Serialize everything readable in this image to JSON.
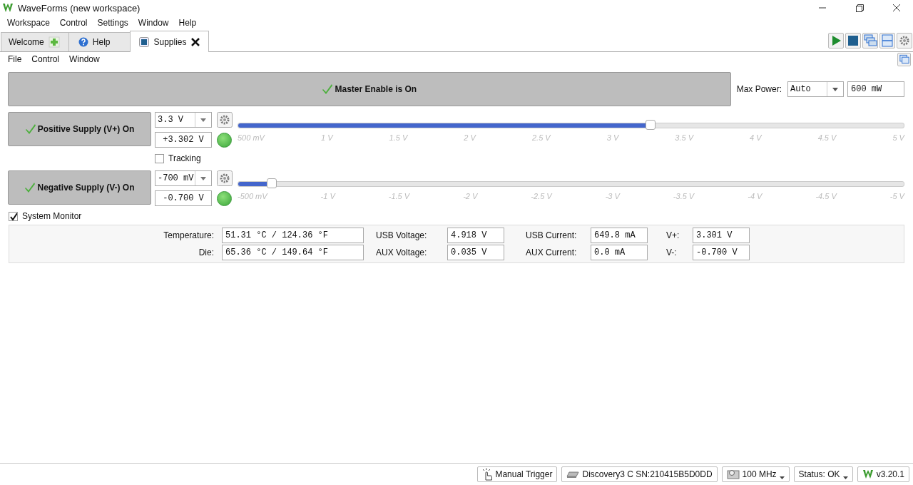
{
  "window": {
    "title": "WaveForms (new workspace)"
  },
  "menu": [
    "Workspace",
    "Control",
    "Settings",
    "Window",
    "Help"
  ],
  "tabs": [
    {
      "label": "Welcome",
      "kind": "plus",
      "selected": false
    },
    {
      "label": "Help",
      "kind": "help",
      "selected": false
    },
    {
      "label": "Supplies",
      "kind": "closable",
      "selected": true
    }
  ],
  "submenu": [
    "File",
    "Control",
    "Window"
  ],
  "master": {
    "label": "Master Enable is On",
    "on": true
  },
  "max_power": {
    "label": "Max Power:",
    "mode": "Auto",
    "value": "600 mW"
  },
  "supplies": [
    {
      "label": "Positive Supply (V+) On",
      "on": true,
      "setpoint": "3.3 V",
      "reading": "+3.302 V",
      "level": 0.62,
      "ticks": [
        "500 mV",
        "1 V",
        "1.5 V",
        "2 V",
        "2.5 V",
        "3 V",
        "3.5 V",
        "4 V",
        "4.5 V",
        "5 V"
      ]
    },
    {
      "label": "Negative Supply (V-) On",
      "on": true,
      "setpoint": "-700 mV",
      "reading": "-0.700 V",
      "level": 0.05,
      "ticks": [
        "-500 mV",
        "-1 V",
        "-1.5 V",
        "-2 V",
        "-2.5 V",
        "-3 V",
        "-3.5 V",
        "-4 V",
        "-4.5 V",
        "-5 V"
      ]
    }
  ],
  "tracking": {
    "label": "Tracking",
    "checked": false
  },
  "system_monitor": {
    "label": "System Monitor",
    "checked": true,
    "fields": [
      {
        "label": "Temperature:",
        "value": "51.31 °C / 124.36 °F"
      },
      {
        "label": "USB Voltage:",
        "value": "4.918 V"
      },
      {
        "label": "USB Current:",
        "value": "649.8 mA"
      },
      {
        "label": "V+:",
        "value": "3.301 V"
      },
      {
        "label": "Die:",
        "value": "65.36 °C / 149.64 °F"
      },
      {
        "label": "AUX Voltage:",
        "value": "0.035 V"
      },
      {
        "label": "AUX Current:",
        "value": "0.0 mA"
      },
      {
        "label": "V-:",
        "value": "-0.700 V"
      }
    ]
  },
  "status_bar": [
    {
      "kind": "trigger",
      "label": "Manual Trigger"
    },
    {
      "kind": "device",
      "label": "Discovery3 C SN:210415B5D0DD"
    },
    {
      "kind": "clock",
      "label": "100 MHz"
    },
    {
      "kind": "status",
      "label": "Status: OK"
    },
    {
      "kind": "version",
      "label": "v3.20.1"
    }
  ]
}
